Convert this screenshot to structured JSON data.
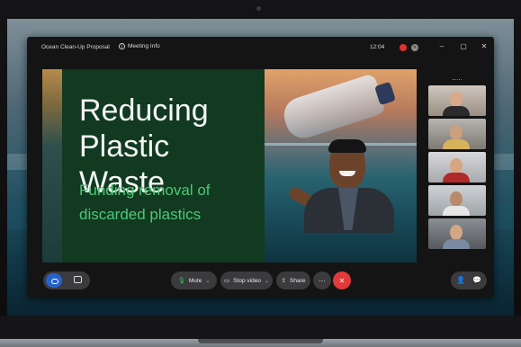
{
  "window": {
    "title": "Ocean Clean-Up Proposal",
    "meeting_info_label": "Meeting Info",
    "clock": "12:04"
  },
  "slide": {
    "heading": "Reducing Plastic Waste",
    "subheading": "Funding removal of discarded plastics"
  },
  "controls": {
    "mute_label": "Mute",
    "stop_video_label": "Stop video",
    "share_label": "Share",
    "more_label": "···"
  },
  "icons": {
    "info": "info-icon",
    "record": "record-icon",
    "settings": "settings-icon",
    "minimize": "minimize-icon",
    "maximize": "maximize-icon",
    "close": "close-icon",
    "mic": "microphone-icon",
    "video": "video-camera-icon",
    "share": "share-icon",
    "end_call": "end-call-icon",
    "participants": "participants-icon",
    "chat": "chat-icon",
    "ai_assistant": "ai-assistant-icon"
  },
  "colors": {
    "slide_green": "#123a20",
    "accent_green": "#4cc876",
    "end_call_red": "#e23a3a",
    "record_red": "#e03131",
    "ai_blue": "#2563c9"
  }
}
